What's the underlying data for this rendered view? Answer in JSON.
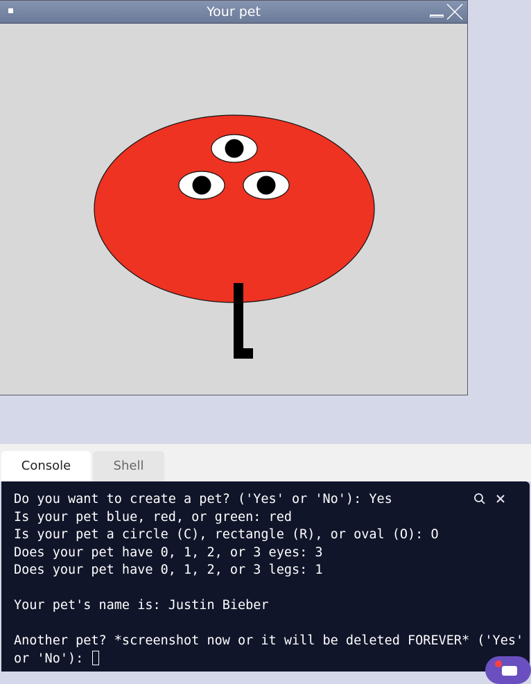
{
  "window": {
    "title": "Your pet"
  },
  "pet": {
    "color": "#ee3322",
    "shape": "oval",
    "eyes": 3,
    "legs": 1
  },
  "tabs": {
    "console_label": "Console",
    "shell_label": "Shell"
  },
  "console": {
    "lines": [
      "Do you want to create a pet? ('Yes' or 'No'): Yes",
      "Is your pet blue, red, or green: red",
      "Is your pet a circle (C), rectangle (R), or oval (O): O",
      "Does your pet have 0, 1, 2, or 3 eyes: 3",
      "Does your pet have 0, 1, 2, or 3 legs: 1",
      "",
      "Your pet's name is: Justin Bieber",
      "",
      "Another pet? *screenshot now or it will be deleted FOREVER* ('Yes'",
      "or 'No'): "
    ],
    "search_icon": "search-icon",
    "close_icon": "close-icon"
  },
  "colors": {
    "console_bg": "#11152a",
    "titlebar": "#7585a3",
    "canvas_bg": "#d8d8d8",
    "accent_fab": "#6a4fc0"
  }
}
